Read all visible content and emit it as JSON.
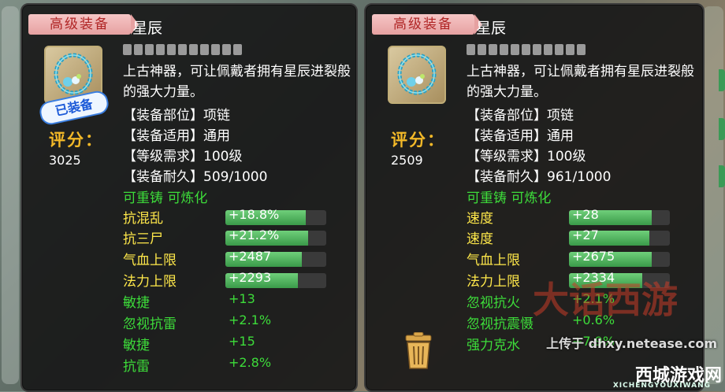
{
  "watermark": "上传于 dhxy.netease.com",
  "logo_text": "大话西游",
  "site": {
    "name": "西城游戏网",
    "sub": "XICHENGYOUXIWANG"
  },
  "colors": {
    "tab_bg": "#e6a1a1",
    "tab_text": "#b02525",
    "score": "#f3b928",
    "green": "#3ddc3a",
    "yellow": "#ffe84a",
    "bar_fill": "#3a9a49"
  },
  "panels": [
    {
      "tab_label": "高级装备",
      "name": "星辰",
      "equipped_badge": "已装备",
      "score_label": "评分：",
      "score_value": "3025",
      "icon": "necklace-icon",
      "description": "上古神器，可让佩戴者拥有星辰进裂般的强大力量。",
      "info": [
        "【装备部位】项链",
        "【装备适用】通用",
        "【等级需求】100级",
        "【装备耐久】509/1000"
      ],
      "refine": "可重铸 可炼化",
      "bar_stats": [
        {
          "label": "抗混乱",
          "value": "+18.8%",
          "fill": 0.8
        },
        {
          "label": "抗三尸",
          "value": "+21.2%",
          "fill": 0.82
        },
        {
          "label": "气血上限",
          "value": "+2487",
          "fill": 0.76
        },
        {
          "label": "法力上限",
          "value": "+2293",
          "fill": 0.72
        }
      ],
      "plain_stats": [
        {
          "label": "敏捷",
          "value": "+13"
        },
        {
          "label": "忽视抗雷",
          "value": "+2.1%"
        },
        {
          "label": "敏捷",
          "value": "+15"
        },
        {
          "label": "抗雷",
          "value": "+2.8%"
        }
      ]
    },
    {
      "tab_label": "高级装备",
      "name": "星辰",
      "score_label": "评分：",
      "score_value": "2509",
      "icon": "necklace-icon",
      "description": "上古神器，可让佩戴者拥有星辰进裂般的强大力量。",
      "info": [
        "【装备部位】项链",
        "【装备适用】通用",
        "【等级需求】100级",
        "【装备耐久】961/1000"
      ],
      "refine": "可重铸 可炼化",
      "bar_stats": [
        {
          "label": "速度",
          "value": "+28",
          "fill": 0.82
        },
        {
          "label": "速度",
          "value": "+27",
          "fill": 0.8
        },
        {
          "label": "气血上限",
          "value": "+2675",
          "fill": 0.82
        },
        {
          "label": "法力上限",
          "value": "+2334",
          "fill": 0.73
        }
      ],
      "plain_stats": [
        {
          "label": "忽视抗火",
          "value": "+2.1%"
        },
        {
          "label": "忽视抗震慑",
          "value": "+0.6%"
        },
        {
          "label": "强力克水",
          "value": "+7.9%"
        }
      ],
      "trash_icon": "trash-icon"
    }
  ]
}
